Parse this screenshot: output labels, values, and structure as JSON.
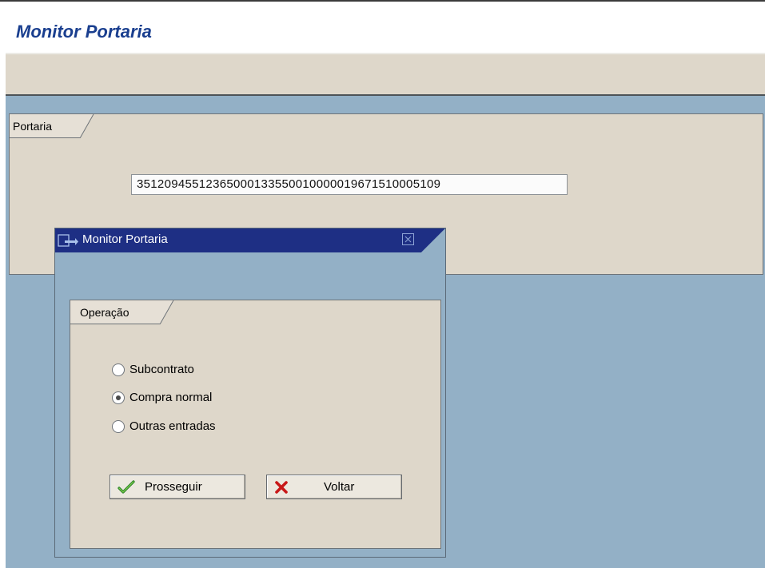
{
  "app": {
    "title": "Monitor Portaria"
  },
  "portaria_group": {
    "label": "Portaria",
    "field_value": "35120945512365000133550010000019671510005109"
  },
  "dialog": {
    "title": "Monitor Portaria",
    "group_label": "Operação",
    "options": [
      {
        "label": "Subcontrato",
        "selected": false
      },
      {
        "label": "Compra normal",
        "selected": true
      },
      {
        "label": "Outras entradas",
        "selected": false
      }
    ],
    "buttons": {
      "continue": "Prosseguir",
      "back": "Voltar"
    }
  },
  "colors": {
    "title_blue": "#1a3f8f",
    "dialog_title": "#1e2f84",
    "panel": "#ded7ca",
    "background": "#93b0c6"
  },
  "icons": {
    "dialog": "window-icon",
    "close": "close-icon",
    "continue": "checkmark-icon",
    "back": "cancel-x-icon"
  }
}
